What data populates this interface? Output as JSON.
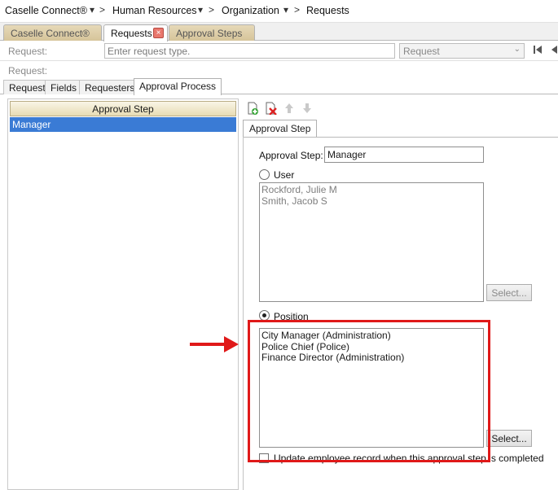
{
  "breadcrumb": {
    "items": [
      "Caselle Connect®",
      "Human Resources",
      "Organization",
      "Requests"
    ],
    "separator": ">"
  },
  "doc_tabs": [
    {
      "label": "Caselle Connect®",
      "active": false
    },
    {
      "label": "Requests",
      "active": true,
      "close": "×"
    },
    {
      "label": "Approval Steps",
      "active": false
    }
  ],
  "request_row": {
    "label": "Request:",
    "placeholder": "Enter request type.",
    "select_value": "Request"
  },
  "request_label2": "Request:",
  "inner_tabs": [
    "Request",
    "Fields",
    "Requesters",
    "Approval Process"
  ],
  "left_pane": {
    "header": "Approval Step",
    "rows": [
      "Manager"
    ]
  },
  "toolbar": {
    "icons": [
      "add-icon",
      "delete-icon",
      "move-up-icon",
      "move-down-icon"
    ]
  },
  "subtab": "Approval Step",
  "form": {
    "approval_step_label": "Approval Step:",
    "approval_step_value": "Manager",
    "user_radio_label": "User",
    "users": [
      "Rockford, Julie M",
      "Smith, Jacob S"
    ],
    "select_label": "Select...",
    "position_radio_label": "Position",
    "positions": [
      "City Manager (Administration)",
      "Police Chief (Police)",
      "Finance Director (Administration)"
    ],
    "update_checkbox_label": "Update employee record when this approval step is completed"
  },
  "colors": {
    "highlight": "#e01919",
    "selection": "#3a7bd5"
  }
}
